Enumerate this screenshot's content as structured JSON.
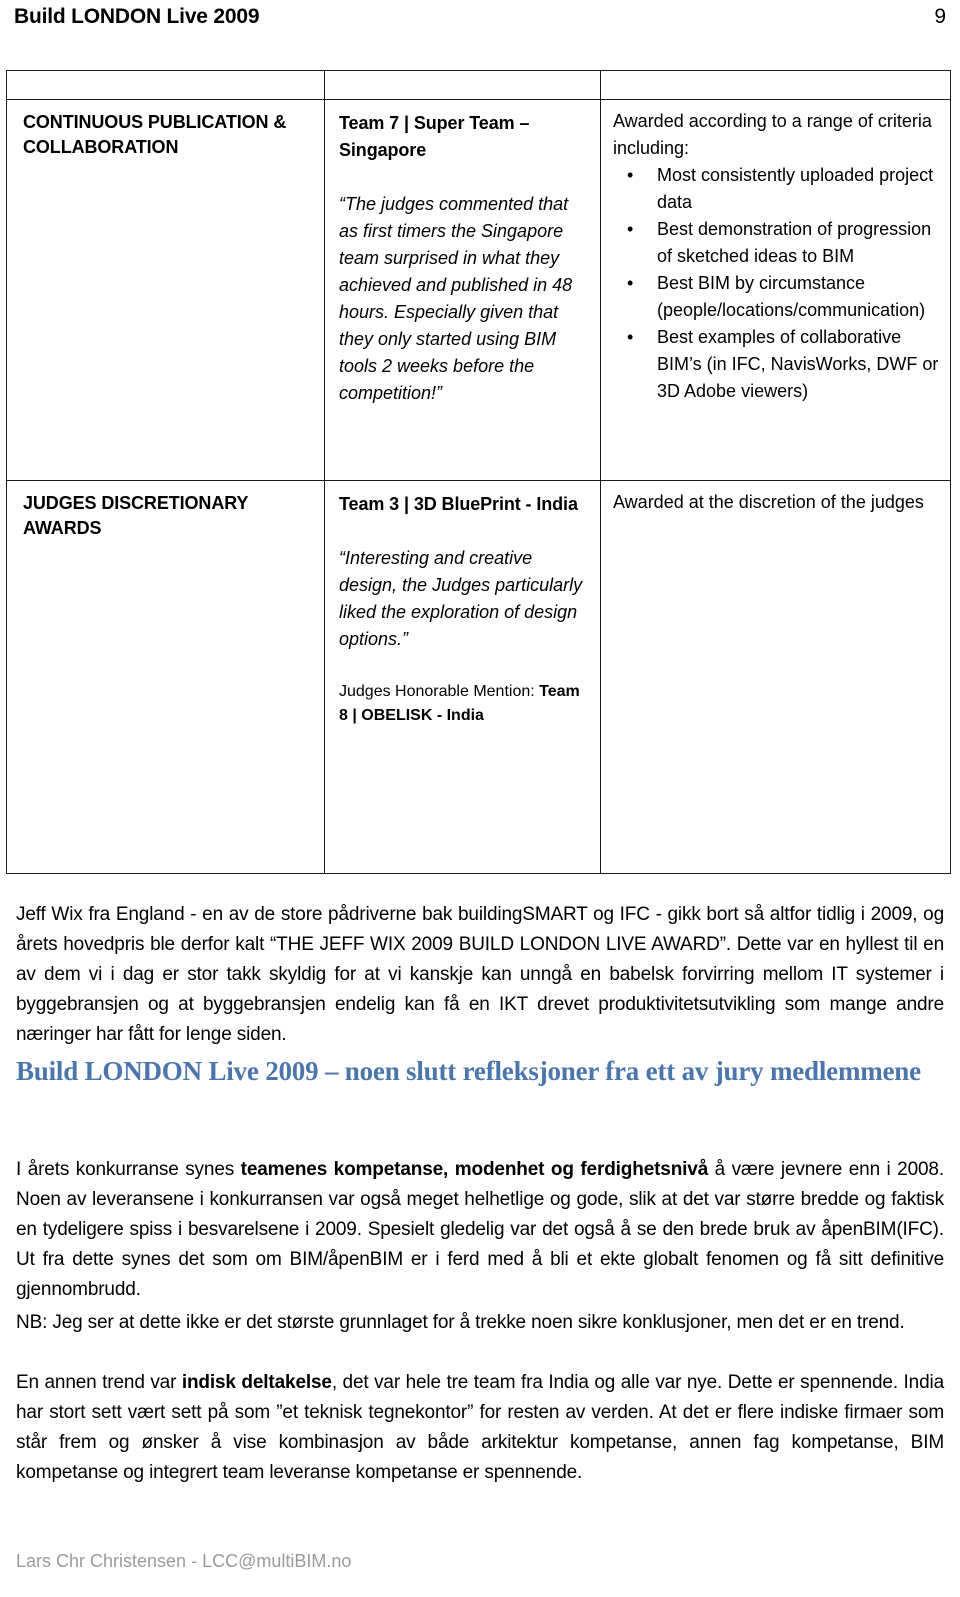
{
  "header": {
    "title": "Build LONDON Live 2009",
    "page_number": "9"
  },
  "award_table": {
    "rows": [
      {
        "category": "CONTINUOUS PUBLICATION & COLLABORATION",
        "team": "Team 7 | Super Team – Singapore",
        "quote": "“The judges commented that as first timers the Singapore team surprised in what they achieved and published in 48 hours. Especially given that they only started using BIM tools 2 weeks before the competition!”",
        "criteria_intro": "Awarded according to a range of criteria including:",
        "criteria": [
          "Most consistently uploaded project data",
          "Best demonstration of progression of sketched ideas to BIM",
          "Best BIM by circumstance (people/locations/communication)",
          "Best examples of collaborative BIM’s (in IFC, NavisWorks, DWF or 3D Adobe viewers)"
        ],
        "bullet_glyph": "•"
      },
      {
        "category": "JUDGES DISCRETIONARY AWARDS",
        "team": "Team 3 | 3D BluePrint - India",
        "quote": "“Interesting and creative design, the Judges particularly liked the exploration of design options.”",
        "mention_prefix": "Judges Honorable Mention: ",
        "mention_team": "Team 8 | OBELISK - India",
        "criteria_intro": "Awarded at the discretion of the judges"
      }
    ]
  },
  "body": {
    "para_intro_part1": "Jeff Wix fra England - en av de store pådriverne bak buildingSMART og IFC - gikk bort så altfor tidlig i 2009, og årets hovedpris ble derfor kalt “THE JEFF WIX 2009 BUILD LONDON LIVE AWARD”. Dette var en hyllest til en av dem vi i dag er stor takk skyldig for at vi kanskje kan unngå en babelsk forvirring mellom IT systemer i byggebransjen og at byggebransjen endelig kan få en IKT drevet produktivitetsutvikling som mange andre næringer har fått for lenge siden.",
    "heading_blue": "Build LONDON Live 2009 – noen slutt refleksjoner fra ett av jury medlemmene",
    "para2_a": "I årets konkurranse synes ",
    "para2_bold": "teamenes kompetanse, modenhet og ferdighetsnivå",
    "para2_b": " å være jevnere enn i 2008. Noen av leveransene i konkurransen var også meget helhetlige og gode, slik at det var større bredde og faktisk en tydeligere spiss i besvarelsene i 2009. Spesielt gledelig var det også å se den brede bruk av åpenBIM(IFC). Ut fra dette synes det som om BIM/åpenBIM er i ferd med å bli et ekte globalt fenomen og få sitt definitive gjennombrudd.",
    "para3": "NB: Jeg ser at dette ikke er det største grunnlaget for å trekke noen sikre konklusjoner, men det er en trend.",
    "para4_a": "En annen trend var ",
    "para4_bold": "indisk deltakelse",
    "para4_b": ", det var hele tre team fra India og alle var nye. Dette er spennende. India har stort sett vært sett på som ”et teknisk tegnekontor” for resten av verden. At det er flere indiske firmaer som står frem og ønsker å vise kombinasjon av både arkitektur kompetanse, annen fag kompetanse, BIM kompetanse og integrert team leveranse kompetanse er spennende."
  },
  "footer": {
    "text": "Lars Chr Christensen -  LCC@multiBIM.no"
  },
  "colors": {
    "heading_blue": "#4a76ab",
    "footer_grey": "#9a9a9a",
    "table_border": "#1b1b1b"
  }
}
